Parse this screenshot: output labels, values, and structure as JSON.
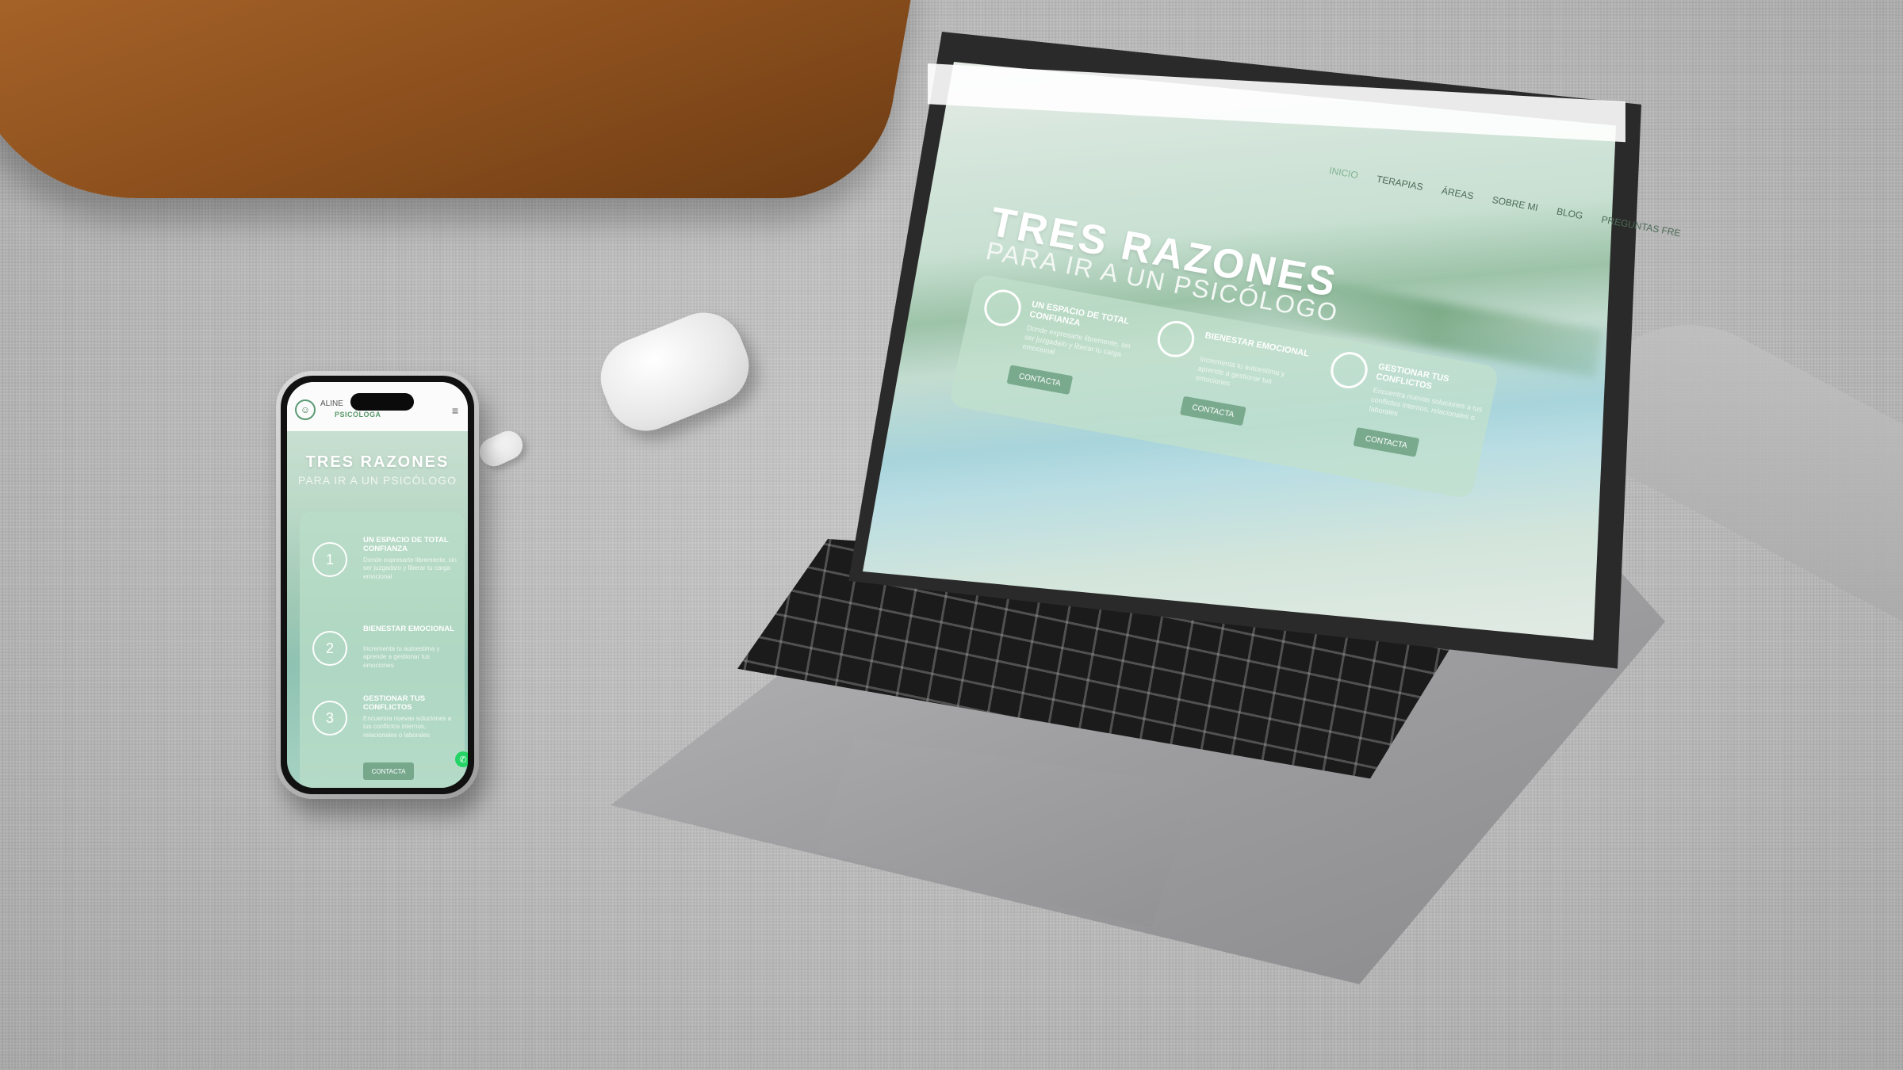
{
  "phone": {
    "brand": "ALINE",
    "role": "PSICÓLOGA",
    "title": "TRES RAZONES",
    "subtitle": "PARA IR A UN PSICÓLOGO",
    "items": [
      {
        "num": "1",
        "title": "UN ESPACIO DE TOTAL CONFIANZA",
        "text": "Donde expresarte libremente, sin ser juzgada/o y liberar tu carga emocional"
      },
      {
        "num": "2",
        "title": "BIENESTAR EMOCIONAL",
        "text": "Incrementa tu autoestima y aprende a gestionar tus emociones"
      },
      {
        "num": "3",
        "title": "GESTIONAR TUS CONFLICTOS",
        "text": "Encuentra nuevas soluciones a tus conflictos internos, relacionales o laborales"
      }
    ],
    "button": "CONTACTA",
    "whatsapp_icon": "whatsapp-icon",
    "menu_icon": "hamburger-icon"
  },
  "laptop": {
    "nav": [
      "INICIO",
      "TERAPIAS",
      "ÁREAS",
      "SOBRE MI",
      "BLOG",
      "PREGUNTAS FRE"
    ],
    "title": "TRES RAZONES",
    "subtitle": "PARA IR A UN PSICÓLOGO",
    "items": [
      {
        "title": "UN ESPACIO DE TOTAL CONFIANZA",
        "text": "Donde expresarte libremente, sin ser juzgada/o y liberar tu carga emocional",
        "button": "CONTACTA"
      },
      {
        "title": "BIENESTAR EMOCIONAL",
        "text": "Incrementa tu autoestima y aprende a gestionar tus emociones",
        "button": "CONTACTA"
      },
      {
        "title": "GESTIONAR TUS CONFLICTOS",
        "text": "Encuentra nuevas soluciones a tus conflictos internos, relacionales o laborales",
        "button": "CONTACTA"
      }
    ]
  },
  "colors": {
    "accent": "#7aaa8e",
    "brand_green": "#5a9a6c",
    "pillow": "#8b4f1d"
  }
}
